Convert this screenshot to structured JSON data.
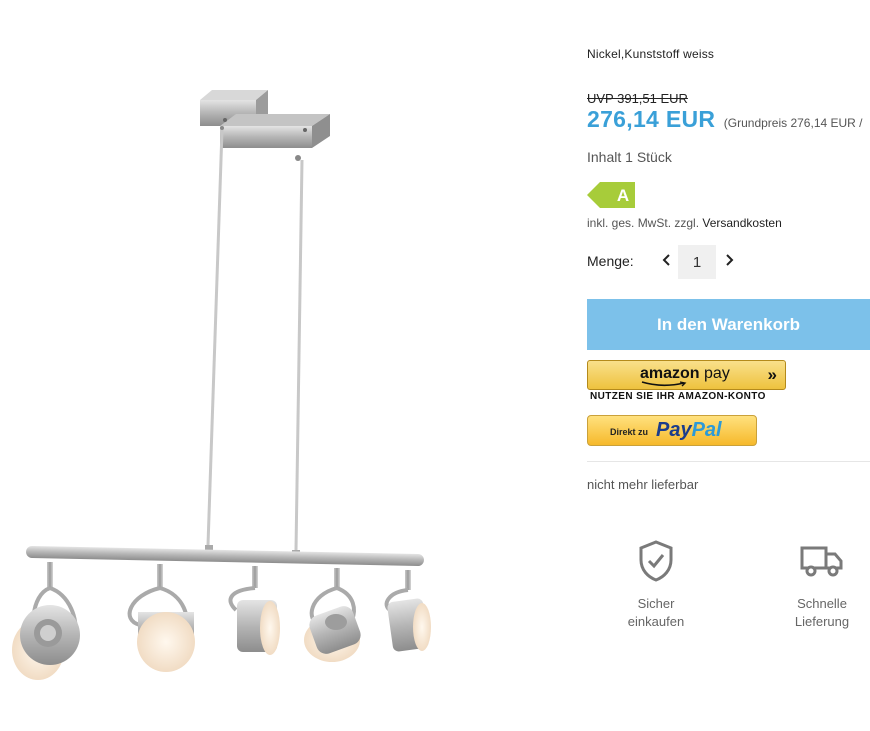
{
  "product": {
    "material": "Nickel,Kunststoff weiss",
    "uvp": "UVP 391,51 EUR",
    "price": "276,14 EUR",
    "base_price": "(Grundpreis 276,14 EUR /",
    "content": "Inhalt 1 Stück",
    "energy_class": "A",
    "energy_color": "#a7cc3a",
    "vat_text": "inkl. ges. MwSt. zzgl.",
    "shipping_link": "Versandkosten",
    "availability": "nicht mehr lieferbar"
  },
  "quantity": {
    "label": "Menge:",
    "value": "1"
  },
  "buttons": {
    "cart_label": "In den Warenkorb",
    "cart_color": "#7cc1ea",
    "amazon_label_a": "amazon",
    "amazon_label_b": "pay",
    "amazon_sub": "NUTZEN SIE IHR AMAZON-KONTO",
    "paypal_prefix": "Direkt zu",
    "paypal_a": "Pay",
    "paypal_b": "Pal"
  },
  "features": [
    {
      "icon": "shield-check-icon",
      "label": "Sicher\neinkaufen"
    },
    {
      "icon": "delivery-truck-icon",
      "label": "Schnelle\nLieferung"
    }
  ],
  "colors": {
    "price": "#3aa0d8",
    "icon_gray": "#7a7a7a"
  }
}
